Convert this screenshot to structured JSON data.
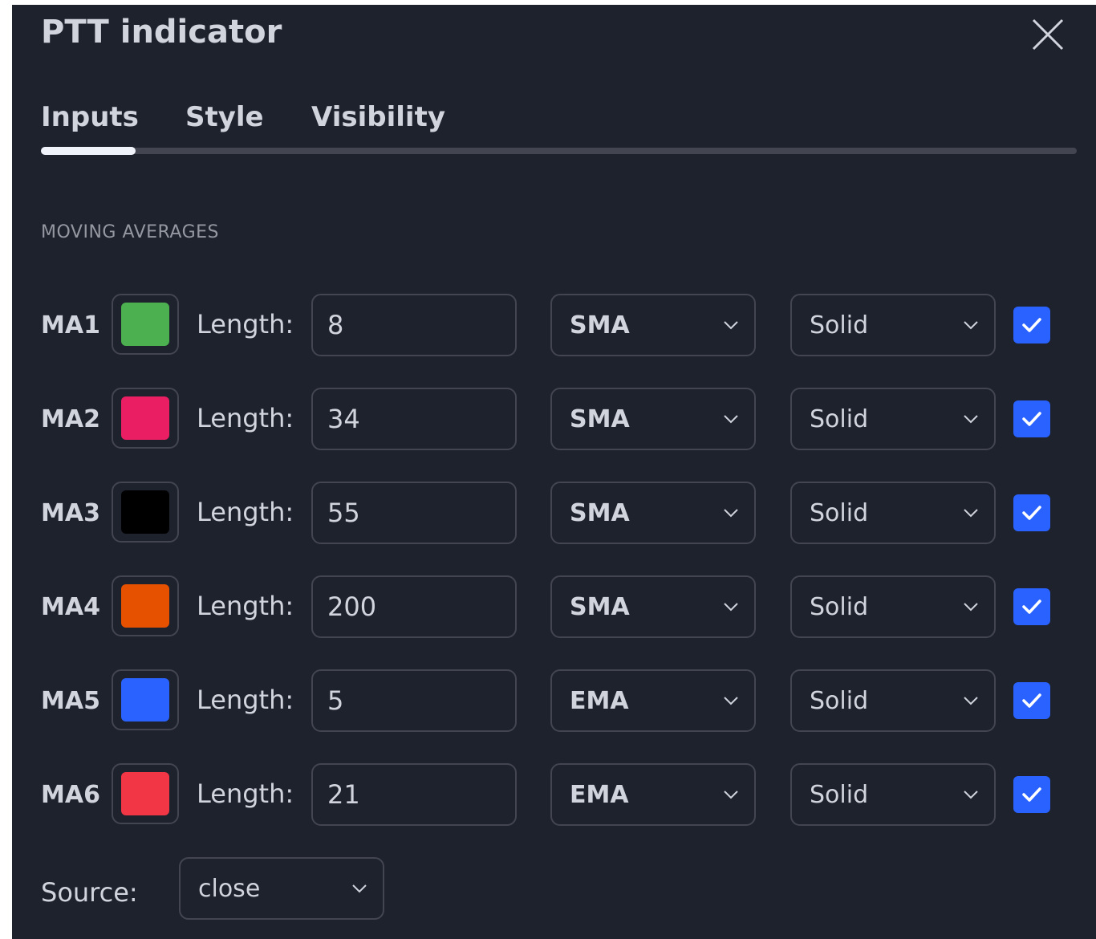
{
  "dialog": {
    "title": "PTT indicator",
    "close_icon": "close-icon"
  },
  "tabs": [
    {
      "label": "Inputs",
      "active": true
    },
    {
      "label": "Style",
      "active": false
    },
    {
      "label": "Visibility",
      "active": false
    }
  ],
  "section": {
    "title": "MOVING AVERAGES"
  },
  "length_label": "Length:",
  "moving_averages": [
    {
      "label": "MA1",
      "color": "#4caf50",
      "length": "8",
      "type": "SMA",
      "line_style": "Solid",
      "enabled": true
    },
    {
      "label": "MA2",
      "color": "#e91e63",
      "length": "34",
      "type": "SMA",
      "line_style": "Solid",
      "enabled": true
    },
    {
      "label": "MA3",
      "color": "#000000",
      "length": "55",
      "type": "SMA",
      "line_style": "Solid",
      "enabled": true
    },
    {
      "label": "MA4",
      "color": "#e65100",
      "length": "200",
      "type": "SMA",
      "line_style": "Solid",
      "enabled": true
    },
    {
      "label": "MA5",
      "color": "#2962ff",
      "length": "5",
      "type": "EMA",
      "line_style": "Solid",
      "enabled": true
    },
    {
      "label": "MA6",
      "color": "#f23645",
      "length": "21",
      "type": "EMA",
      "line_style": "Solid",
      "enabled": true
    }
  ],
  "source": {
    "label": "Source:",
    "value": "close"
  },
  "colors": {
    "background": "#1e222d",
    "text": "#d1d4dc",
    "muted": "#9598a1",
    "border": "#434651",
    "accent": "#2962ff"
  }
}
